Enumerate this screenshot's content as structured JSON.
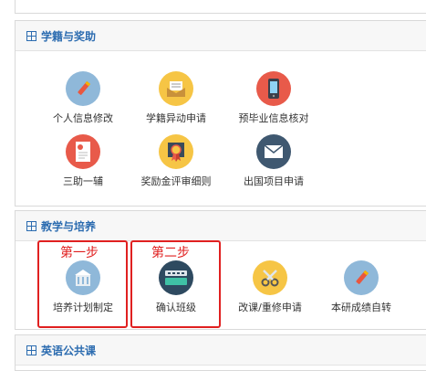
{
  "sections": {
    "status": {
      "title": "学籍与奖助",
      "items": [
        {
          "label": "个人信息修改",
          "icon": "pencil-icon",
          "color": "#8fb8d9"
        },
        {
          "label": "学籍异动申请",
          "icon": "envelope-open-icon",
          "color": "#f6c545"
        },
        {
          "label": "预毕业信息核对",
          "icon": "phone-icon",
          "color": "#e85a4a"
        },
        {
          "label": "三助一辅",
          "icon": "document-icon",
          "color": "#e85a4a"
        },
        {
          "label": "奖励金评审细则",
          "icon": "award-ribbon-icon",
          "color": "#f6c545"
        },
        {
          "label": "出国项目申请",
          "icon": "mail-icon",
          "color": "#3f5870"
        }
      ]
    },
    "teaching": {
      "title": "教学与培养",
      "items": [
        {
          "label": "培养计划制定",
          "icon": "building-icon",
          "color": "#8fb8d9"
        },
        {
          "label": "确认班级",
          "icon": "keyboard-icon",
          "color": "#2e4a60"
        },
        {
          "label": "改课/重修申请",
          "icon": "scissors-icon",
          "color": "#f6c545"
        },
        {
          "label": "本研成绩自转",
          "icon": "pencil-icon",
          "color": "#8fb8d9"
        }
      ],
      "annotations": [
        "第一步",
        "第二步"
      ]
    },
    "english": {
      "title": "英语公共课"
    }
  }
}
